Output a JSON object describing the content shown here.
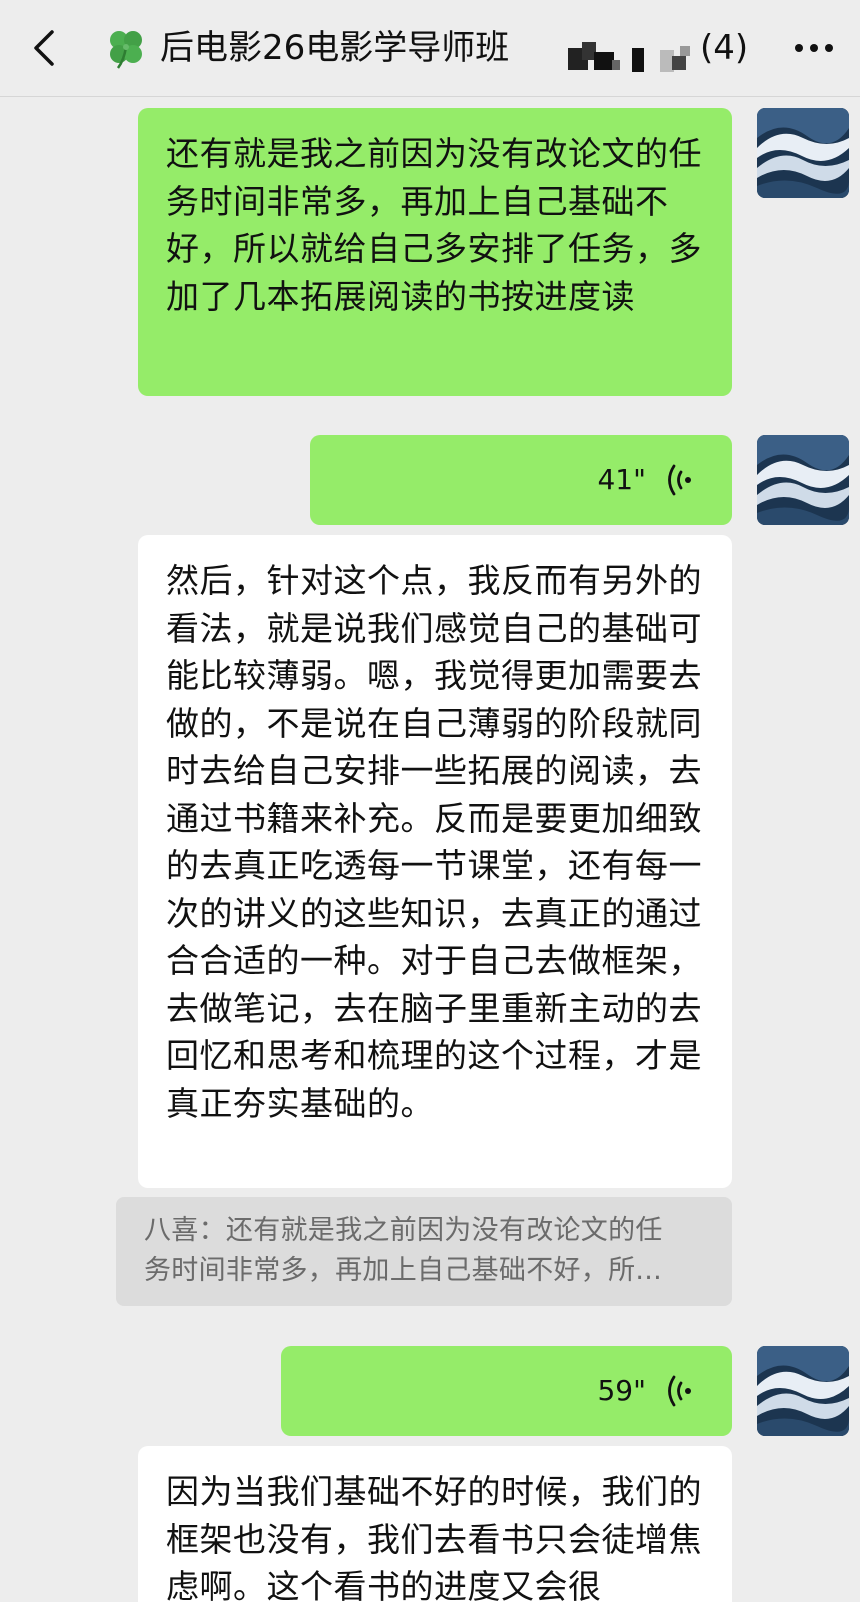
{
  "header": {
    "back_icon": "chevron-left-icon",
    "group_icon": "four-leaf-clover-icon",
    "title": "后电影26电影学导师班",
    "member_count": "(4)",
    "more_icon": "more-dots-icon"
  },
  "messages": [
    {
      "type": "text",
      "side": "right",
      "text": "还有就是我之前因为没有改论文的任务时间非常多，再加上自己基础不好，所以就给自己多安排了任务，多加了几本拓展阅读的书按进度读"
    },
    {
      "type": "voice",
      "side": "right",
      "duration": "41\""
    },
    {
      "type": "text",
      "side": "left",
      "text": "然后，针对这个点，我反而有另外的看法，就是说我们感觉自己的基础可能比较薄弱。嗯，我觉得更加需要去做的，不是说在自己薄弱的阶段就同时去给自己安排一些拓展的阅读，去通过书籍来补充。反而是要更加细致的去真正吃透每一节课堂，还有每一次的讲义的这些知识，去真正的通过合合适的一种。对于自己去做框架，去做笔记，去在脑子里重新主动的去回忆和思考和梳理的这个过程，才是真正夯实基础的。"
    },
    {
      "type": "quote",
      "line1": "八喜：还有就是我之前因为没有改论文的任",
      "line2": "务时间非常多，再加上自己基础不好，所..."
    },
    {
      "type": "voice",
      "side": "right",
      "duration": "59\""
    },
    {
      "type": "text",
      "side": "left",
      "text": "因为当我们基础不好的时候，我们的框架也没有，我们去看书只会徒增焦虑啊。这个看书的进度又会很"
    }
  ],
  "colors": {
    "background": "#ededed",
    "sent_bubble": "#95ec69",
    "received_bubble": "#ffffff",
    "quote_bg": "#dcdcdc"
  }
}
